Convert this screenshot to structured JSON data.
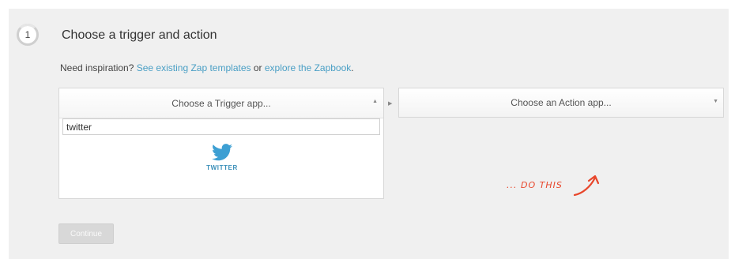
{
  "step": {
    "number": "1",
    "title": "Choose a trigger and action"
  },
  "inspiration": {
    "prefix": "Need inspiration?",
    "link1": "See existing Zap templates",
    "middle": "or",
    "link2": "explore the Zapbook",
    "suffix": "."
  },
  "trigger": {
    "placeholder_label": "Choose a Trigger app...",
    "search_value": "twitter",
    "result_label": "TWITTER"
  },
  "action": {
    "placeholder_label": "Choose an Action app..."
  },
  "annotation": {
    "text": "... DO THIS"
  },
  "buttons": {
    "continue": "Continue"
  },
  "colors": {
    "link": "#4a9fc5",
    "twitter": "#3d9fd3",
    "annotation": "#e8462b"
  }
}
